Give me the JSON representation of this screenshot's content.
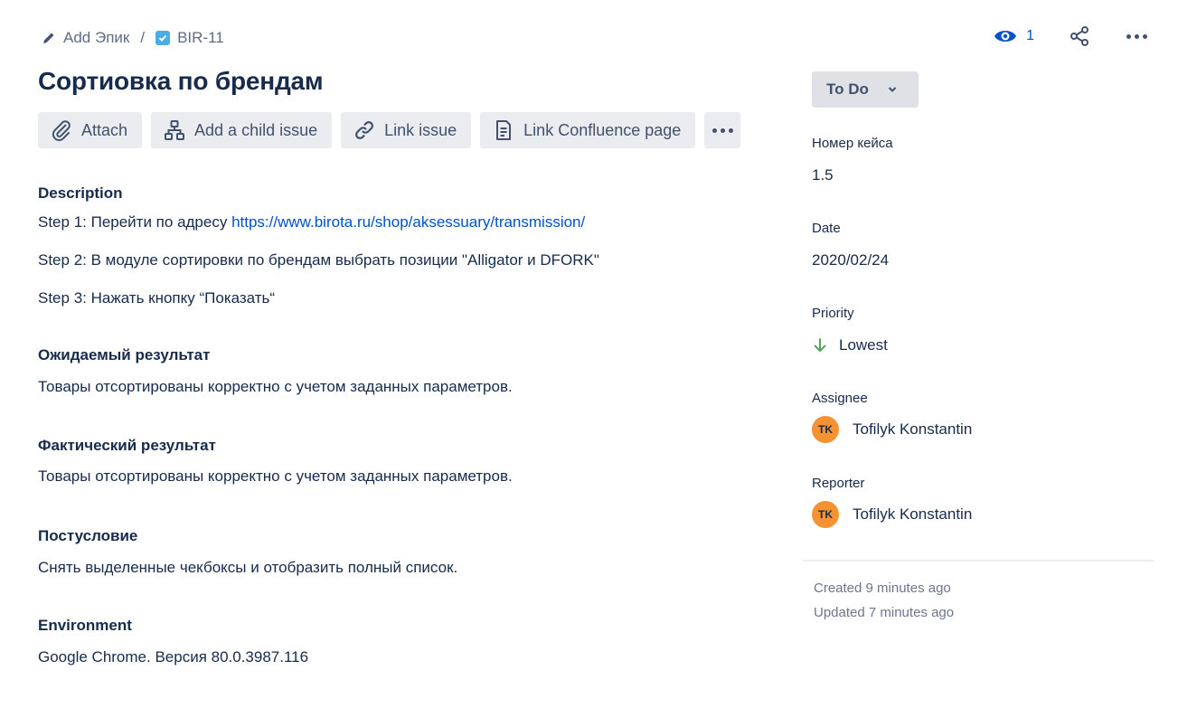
{
  "breadcrumb": {
    "parent_label": "Add Эпик",
    "separator": "/",
    "issue_key": "BIR-11"
  },
  "top_actions": {
    "watch_count": "1"
  },
  "issue": {
    "title": "Сортиовка по брендам"
  },
  "toolbar": {
    "attach": "Attach",
    "add_child": "Add a child issue",
    "link_issue": "Link issue",
    "link_confluence": "Link Confluence page"
  },
  "description": {
    "heading": "Description",
    "step1_prefix": "Step 1: Перейти по адресу ",
    "step1_link": "https://www.birota.ru/shop/aksessuary/transmission/",
    "step2": "Step 2:  В модуле  сортировки по брендам выбрать позиции \"Alligator и DFORK\"",
    "step3": "Step 3: Нажать кнопку “Показать“"
  },
  "expected": {
    "heading": "Ожидаемый результат",
    "text": "Товары отсортированы корректно с учетом заданных параметров."
  },
  "actual": {
    "heading": "Фактический результат",
    "text": "Товары отсортированы корректно с учетом заданных параметров."
  },
  "postcondition": {
    "heading": "Постусловие",
    "text": "Снять выделенные чекбоксы и  отобразить полный список."
  },
  "environment": {
    "heading": "Environment",
    "text": "Google Chrome. Версия 80.0.3987.116"
  },
  "sidebar": {
    "status": "To Do",
    "case_number_label": "Номер кейса",
    "case_number_value": "1.5",
    "date_label": "Date",
    "date_value": "2020/02/24",
    "priority_label": "Priority",
    "priority_value": "Lowest",
    "assignee_label": "Assignee",
    "assignee_initials": "TK",
    "assignee_name": "Tofilyk Konstantin",
    "reporter_label": "Reporter",
    "reporter_initials": "TK",
    "reporter_name": "Tofilyk Konstantin",
    "created": "Created 9 minutes ago",
    "updated": "Updated 7 minutes ago"
  },
  "colors": {
    "link": "#0052CC",
    "issue_type_icon": "#4BADE8",
    "priority_lowest": "#57A55A",
    "avatar_bg": "#F79232",
    "button_bg": "#EBECF0",
    "status_bg": "#DFE1E6"
  },
  "icons": [
    "pencil-icon",
    "task-checkbox-icon",
    "eye-icon",
    "share-icon",
    "more-icon",
    "paperclip-icon",
    "hierarchy-icon",
    "link-icon",
    "confluence-page-icon",
    "chevron-down-icon",
    "arrow-down-icon"
  ]
}
